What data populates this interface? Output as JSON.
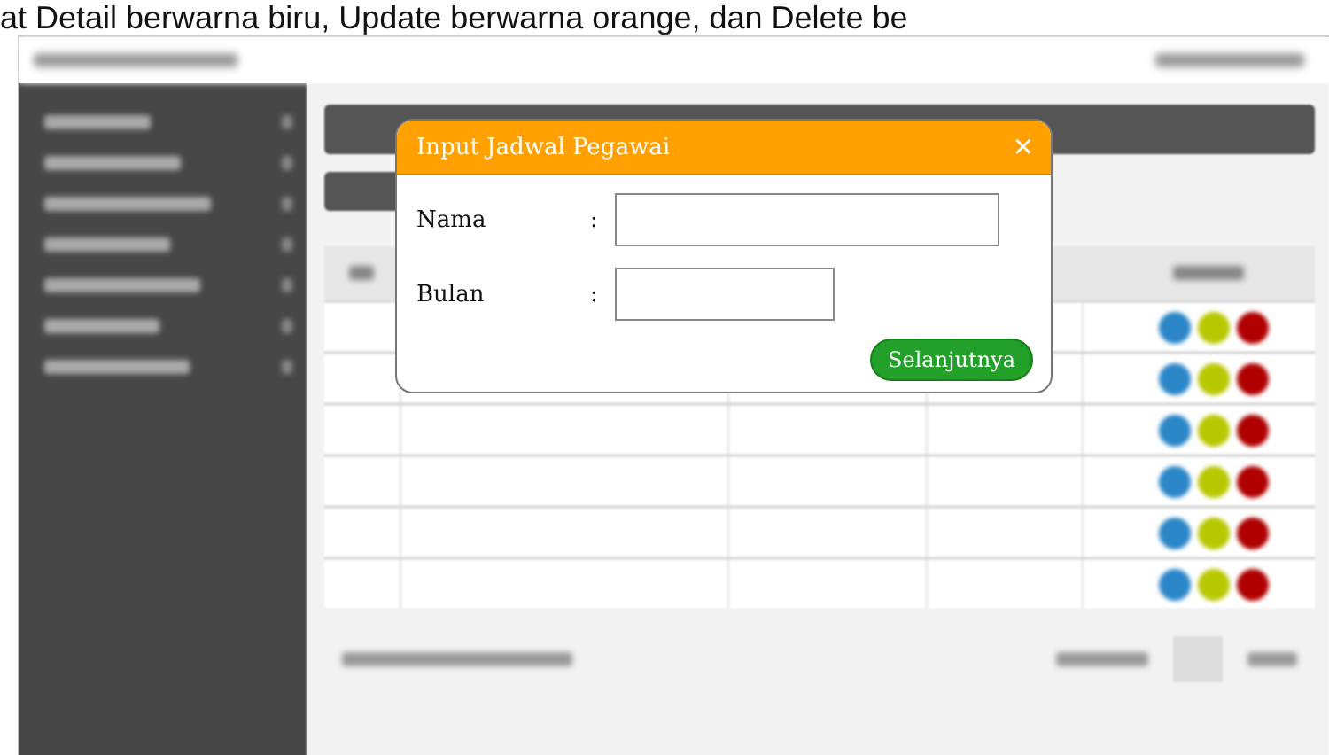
{
  "caption": "at Detail berwarna biru, Update berwarna orange, dan Delete be",
  "sidebar": {
    "items": [
      {
        "kind": "menu"
      },
      {
        "kind": "menu"
      },
      {
        "kind": "menu"
      },
      {
        "kind": "menu"
      },
      {
        "kind": "menu"
      },
      {
        "kind": "menu"
      },
      {
        "kind": "menu"
      }
    ]
  },
  "table": {
    "rows": [
      {
        "actions": [
          {
            "color": "#2b86c8"
          },
          {
            "color": "#b8c800"
          },
          {
            "color": "#b00000"
          }
        ]
      },
      {
        "actions": [
          {
            "color": "#2b86c8"
          },
          {
            "color": "#b8c800"
          },
          {
            "color": "#b00000"
          }
        ]
      },
      {
        "actions": [
          {
            "color": "#2b86c8"
          },
          {
            "color": "#b8c800"
          },
          {
            "color": "#b00000"
          }
        ]
      },
      {
        "actions": [
          {
            "color": "#2b86c8"
          },
          {
            "color": "#b8c800"
          },
          {
            "color": "#b00000"
          }
        ]
      },
      {
        "actions": [
          {
            "color": "#2b86c8"
          },
          {
            "color": "#b8c800"
          },
          {
            "color": "#b00000"
          }
        ]
      },
      {
        "actions": [
          {
            "color": "#2b86c8"
          },
          {
            "color": "#b8c800"
          },
          {
            "color": "#b00000"
          }
        ]
      }
    ]
  },
  "dialog": {
    "title": "Input Jadwal Pegawai",
    "close": "×",
    "fields": [
      {
        "label": "Nama",
        "separator": ":"
      },
      {
        "label": "Bulan",
        "separator": ":"
      }
    ],
    "button": "Selanjutnya"
  }
}
